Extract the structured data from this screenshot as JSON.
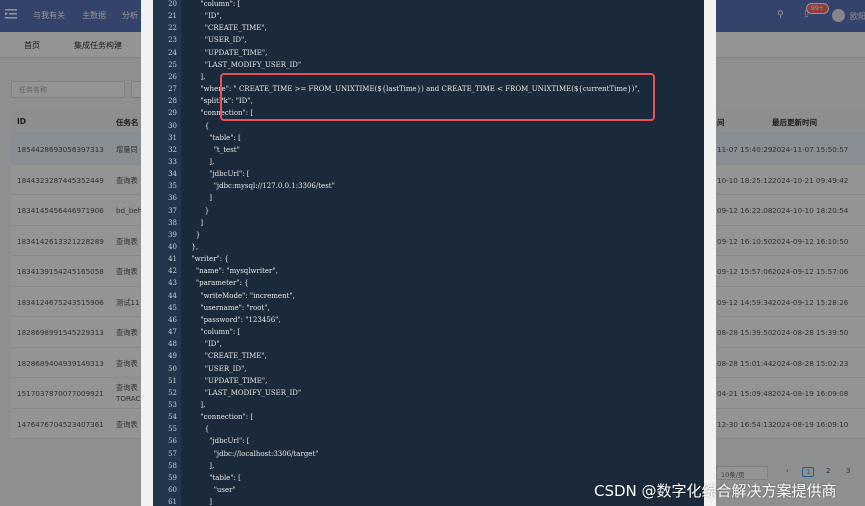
{
  "topbar": {
    "nav": [
      "与我有关",
      "主数据",
      "分析"
    ],
    "badge": "99+",
    "user": "欧阳"
  },
  "tabs": [
    "首页",
    "集成任务构建"
  ],
  "filter": {
    "placeholder": "任务名称"
  },
  "table": {
    "headers": [
      "ID",
      "任务名",
      "间",
      "最后更新时间"
    ],
    "rows": [
      {
        "id": "1854428693056397313",
        "name": "增量同",
        "created": "11-07 15:40:29",
        "updated": "2024-11-07 15:50:57"
      },
      {
        "id": "1844323287445352449",
        "name": "查询表",
        "created": "10-10 18:25:12",
        "updated": "2024-10-21 09:49:42"
      },
      {
        "id": "1834145456446971906",
        "name": "bd_beh",
        "created": "09-12 16:22:08",
        "updated": "2024-10-10 18:20:54"
      },
      {
        "id": "1834142613321228289",
        "name": "查询表",
        "created": "09-12 16:10:50",
        "updated": "2024-09-12 16:10:50"
      },
      {
        "id": "1834139154245165058",
        "name": "查询表",
        "created": "09-12 15:57:06",
        "updated": "2024-09-12 15:57:06"
      },
      {
        "id": "1834124675243515906",
        "name": "测试11",
        "created": "09-12 14:59:34",
        "updated": "2024-09-12 15:28:26"
      },
      {
        "id": "1828698991545229313",
        "name": "查询表",
        "created": "08-28 15:39:50",
        "updated": "2024-08-28 15:39:50"
      },
      {
        "id": "1828689404939149313",
        "name": "查询表",
        "created": "08-28 15:01:44",
        "updated": "2024-08-28 15:02:23"
      },
      {
        "id": "1517037870077009921",
        "name": "查询表",
        "name2": "TORAC",
        "created": "04-21 15:09:48",
        "updated": "2024-08-19 16:09:08"
      },
      {
        "id": "1476476704523407361",
        "name": "查询表",
        "created": "12-30 16:54:13",
        "updated": "2024-08-19 16:09:10"
      }
    ]
  },
  "pager": {
    "size": "10条/页",
    "pages": [
      "1",
      "2",
      "3"
    ],
    "current": "1"
  },
  "code": [
    {
      "n": "20",
      "t": "      \"column\": ["
    },
    {
      "n": "21",
      "t": "        \"ID\","
    },
    {
      "n": "22",
      "t": "        \"CREATE_TIME\","
    },
    {
      "n": "23",
      "t": "        \"USER_ID\","
    },
    {
      "n": "24",
      "t": "        \"UPDATE_TIME\","
    },
    {
      "n": "25",
      "t": "        \"LAST_MODIFY_USER_ID\""
    },
    {
      "n": "26",
      "t": "      ],"
    },
    {
      "n": "27",
      "t": "      \"where\": \" CREATE_TIME >= FROM_UNIXTIME(${lastTime}) and CREATE_TIME < FROM_UNIXTIME(${currentTime})\","
    },
    {
      "n": "28",
      "t": "      \"splitPk\": \"ID\","
    },
    {
      "n": "29",
      "t": "      \"connection\": ["
    },
    {
      "n": "30",
      "t": "        {"
    },
    {
      "n": "31",
      "t": "          \"table\": ["
    },
    {
      "n": "32",
      "t": "            \"t_test\""
    },
    {
      "n": "33",
      "t": "          ],"
    },
    {
      "n": "34",
      "t": "          \"jdbcUrl\": ["
    },
    {
      "n": "35",
      "t": "            \"jdbc:mysql://127.0.0.1:3306/test\""
    },
    {
      "n": "36",
      "t": "          ]"
    },
    {
      "n": "37",
      "t": "        }"
    },
    {
      "n": "38",
      "t": "      ]"
    },
    {
      "n": "39",
      "t": "    }"
    },
    {
      "n": "40",
      "t": "  },"
    },
    {
      "n": "41",
      "t": "  \"writer\": {"
    },
    {
      "n": "42",
      "t": "    \"name\": \"mysqlwriter\","
    },
    {
      "n": "43",
      "t": "    \"parameter\": {"
    },
    {
      "n": "44",
      "t": "      \"writeMode\": \"increment\","
    },
    {
      "n": "45",
      "t": "      \"username\": \"root\","
    },
    {
      "n": "46",
      "t": "      \"password\": \"123456\","
    },
    {
      "n": "47",
      "t": "      \"column\": ["
    },
    {
      "n": "48",
      "t": "        \"ID\","
    },
    {
      "n": "49",
      "t": "        \"CREATE_TIME\","
    },
    {
      "n": "50",
      "t": "        \"USER_ID\","
    },
    {
      "n": "51",
      "t": "        \"UPDATE_TIME\","
    },
    {
      "n": "52",
      "t": "        \"LAST_MODIFY_USER_ID\""
    },
    {
      "n": "53",
      "t": "      ],"
    },
    {
      "n": "54",
      "t": "      \"connection\": ["
    },
    {
      "n": "55",
      "t": "        {"
    },
    {
      "n": "56",
      "t": "          \"jdbcUrl\": ["
    },
    {
      "n": "57",
      "t": "            \"jdbc://localhost:3306/target\""
    },
    {
      "n": "58",
      "t": "          ],"
    },
    {
      "n": "59",
      "t": "          \"table\": ["
    },
    {
      "n": "60",
      "t": "            \"user\""
    },
    {
      "n": "61",
      "t": "          ]"
    }
  ],
  "watermark": "CSDN @数字化综合解决方案提供商",
  "colors": {
    "topbar": "#5a74b8",
    "code_bg": "#1b2a3a",
    "highlight": "#e8505b"
  }
}
